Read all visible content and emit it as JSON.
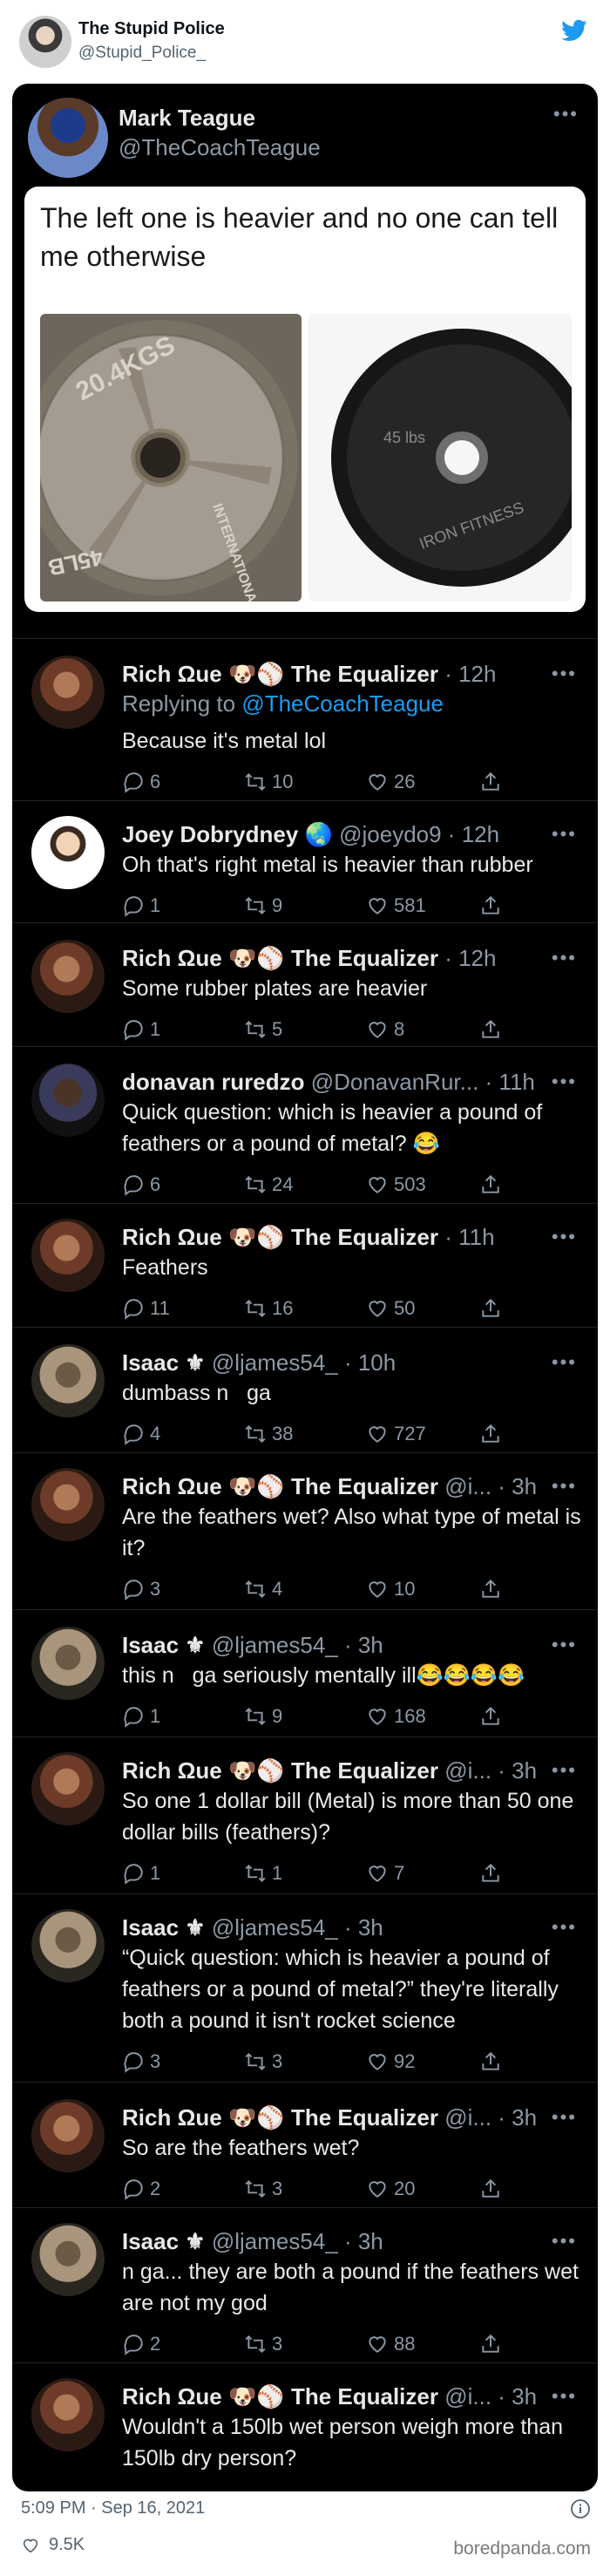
{
  "outer": {
    "name": "The Stupid Police",
    "handle": "@Stupid_Police_",
    "timestamp": "5:09 PM · Sep 16, 2021",
    "likes": "9.5K",
    "watermark": "boredpanda.com"
  },
  "quoted": {
    "name": "Mark Teague",
    "handle": "@TheCoachTeague",
    "text": "The left one is heavier and no one can tell me otherwise",
    "plate_left_label_top": "20.4KGS",
    "plate_left_label_bottom": "45LB",
    "plate_left_label_side": "INTERNATIONAL",
    "plate_right_label": "45 lbs",
    "plate_right_brand": "IRON FITNESS"
  },
  "replies": [
    {
      "name": "Rich Ωue 🐶⚾ The Equalizer",
      "meta": " · 12h",
      "reply_to": "@TheCoachTeague",
      "reply_prefix": "Replying to ",
      "text": "Because it's metal lol",
      "replies": "6",
      "retweets": "10",
      "likes": "26",
      "avatar": "rich"
    },
    {
      "name": "Joey Dobrydney 🌏",
      "meta": " @joeydo9 · 12h",
      "text": "Oh that's right metal is heavier than rubber",
      "replies": "1",
      "retweets": "9",
      "likes": "581",
      "avatar": "joey"
    },
    {
      "name": "Rich Ωue 🐶⚾ The Equalizer",
      "meta": " · 12h",
      "text": "Some rubber plates are heavier",
      "replies": "1",
      "retweets": "5",
      "likes": "8",
      "avatar": "rich"
    },
    {
      "name": "donavan ruredzo",
      "meta": " @DonavanRur... · 11h",
      "text": "Quick question: which is heavier a pound of feathers or a pound of metal? 😂",
      "replies": "6",
      "retweets": "24",
      "likes": "503",
      "avatar": "donavan"
    },
    {
      "name": "Rich Ωue 🐶⚾ The Equalizer",
      "meta": " · 11h",
      "text": "Feathers",
      "replies": "11",
      "retweets": "16",
      "likes": "50",
      "avatar": "rich"
    },
    {
      "name": "Isaac ⚜",
      "meta": " @ljames54_ · 10h",
      "text": "dumbass n   ga",
      "replies": "4",
      "retweets": "38",
      "likes": "727",
      "avatar": "isaac"
    },
    {
      "name": "Rich Ωue 🐶⚾ The Equalizer",
      "meta": " @i... · 3h",
      "text": "Are the feathers wet? Also what type of metal is it?",
      "replies": "3",
      "retweets": "4",
      "likes": "10",
      "avatar": "rich"
    },
    {
      "name": "Isaac ⚜",
      "meta": " @ljames54_ · 3h",
      "text": "this n   ga seriously mentally ill😂😂😂😂",
      "replies": "1",
      "retweets": "9",
      "likes": "168",
      "avatar": "isaac"
    },
    {
      "name": "Rich Ωue 🐶⚾ The Equalizer",
      "meta": " @i... · 3h",
      "text": "So one 1 dollar bill (Metal) is more than 50 one dollar bills (feathers)?",
      "replies": "1",
      "retweets": "1",
      "likes": "7",
      "avatar": "rich"
    },
    {
      "name": "Isaac ⚜",
      "meta": " @ljames54_ · 3h",
      "text": "“Quick question: which is heavier a pound of feathers or a pound of metal?” they're literally both a pound it isn't rocket science",
      "replies": "3",
      "retweets": "3",
      "likes": "92",
      "avatar": "isaac"
    },
    {
      "name": "Rich Ωue 🐶⚾ The Equalizer",
      "meta": " @i... · 3h",
      "text": "So are the feathers wet?",
      "replies": "2",
      "retweets": "3",
      "likes": "20",
      "avatar": "rich"
    },
    {
      "name": "Isaac ⚜",
      "meta": " @ljames54_ · 3h",
      "text": "n   ga... they are both a pound if the feathers wet are not my god",
      "replies": "2",
      "retweets": "3",
      "likes": "88",
      "avatar": "isaac"
    },
    {
      "name": "Rich Ωue 🐶⚾ The Equalizer",
      "meta": " @i... · 3h",
      "text": "Wouldn't a 150lb wet person weigh more than 150lb dry person?",
      "avatar": "rich"
    }
  ]
}
